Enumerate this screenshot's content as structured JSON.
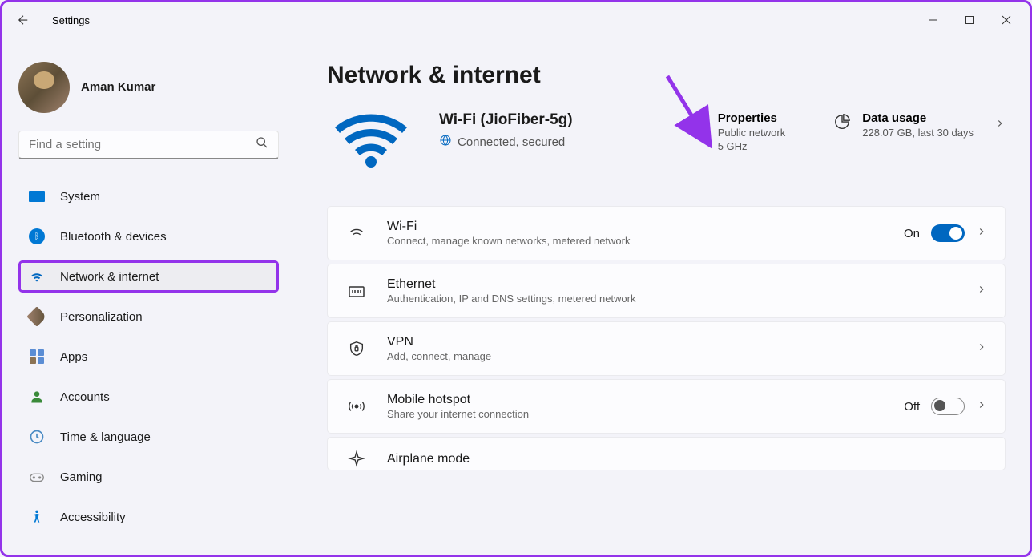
{
  "app_title": "Settings",
  "user": {
    "name": "Aman Kumar",
    "subtitle": "                    "
  },
  "search": {
    "placeholder": "Find a setting"
  },
  "nav": [
    {
      "id": "system",
      "label": "System"
    },
    {
      "id": "bluetooth",
      "label": "Bluetooth & devices"
    },
    {
      "id": "network",
      "label": "Network & internet"
    },
    {
      "id": "personalization",
      "label": "Personalization"
    },
    {
      "id": "apps",
      "label": "Apps"
    },
    {
      "id": "accounts",
      "label": "Accounts"
    },
    {
      "id": "time",
      "label": "Time & language"
    },
    {
      "id": "gaming",
      "label": "Gaming"
    },
    {
      "id": "accessibility",
      "label": "Accessibility"
    }
  ],
  "page_title": "Network & internet",
  "wifi": {
    "ssid": "Wi-Fi (JioFiber-5g)",
    "status": "Connected, secured"
  },
  "properties": {
    "title": "Properties",
    "line1": "Public network",
    "line2": "5 GHz"
  },
  "data_usage": {
    "title": "Data usage",
    "sub": "228.07 GB, last 30 days"
  },
  "cards": {
    "wifi": {
      "title": "Wi-Fi",
      "sub": "Connect, manage known networks, metered network",
      "toggle_label": "On",
      "toggle_state": "on"
    },
    "ethernet": {
      "title": "Ethernet",
      "sub": "Authentication, IP and DNS settings, metered network"
    },
    "vpn": {
      "title": "VPN",
      "sub": "Add, connect, manage"
    },
    "hotspot": {
      "title": "Mobile hotspot",
      "sub": "Share your internet connection",
      "toggle_label": "Off",
      "toggle_state": "off"
    },
    "airplane": {
      "title": "Airplane mode"
    }
  }
}
